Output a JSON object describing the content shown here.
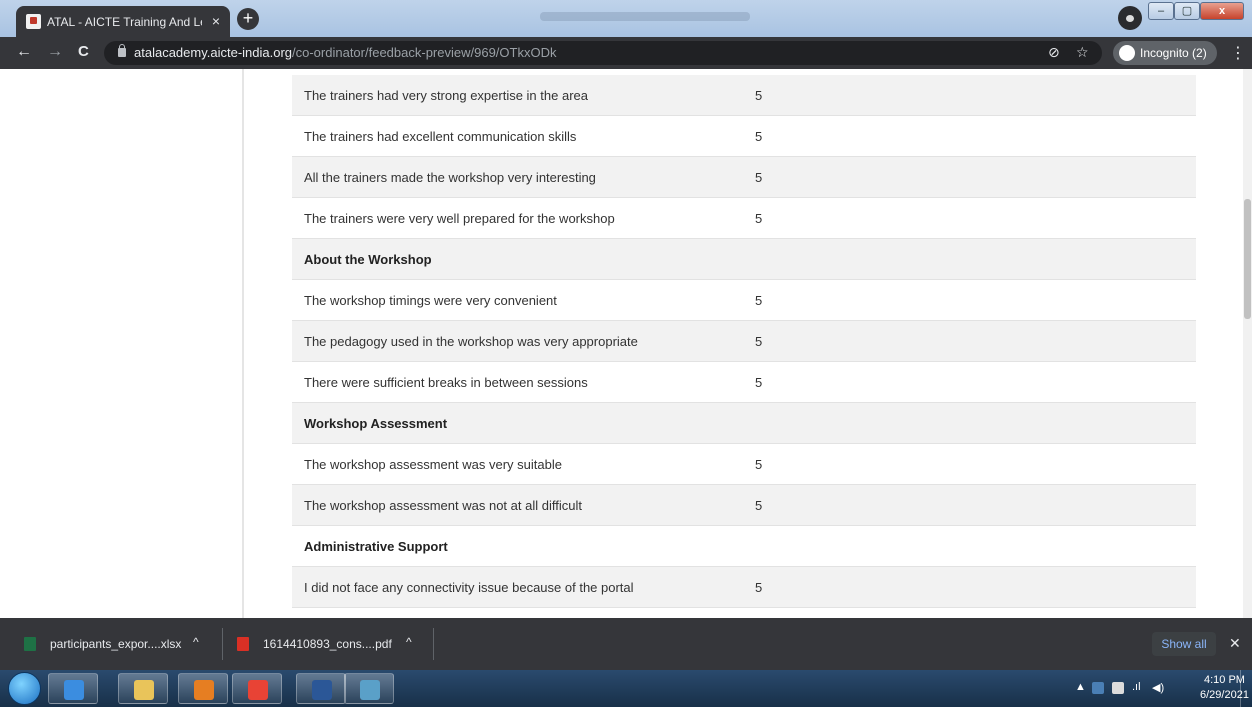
{
  "browser": {
    "tab_title": "ATAL - AICTE Training And Learn",
    "tab_close": "×",
    "new_tab": "+",
    "url_host": "atalacademy.aicte-india.org",
    "url_path": "/co-ordinator/feedback-preview/969/OTkxODk",
    "incognito_label": "Incognito (2)",
    "window_buttons": {
      "minimize": "–",
      "maximize": "▢",
      "close": "x"
    },
    "nav": {
      "back": "←",
      "forward": "→",
      "reload": "C"
    },
    "menu": "⋮"
  },
  "feedback_rows": [
    {
      "question": "The trainers had very strong expertise in the area",
      "rating": "5",
      "section": false
    },
    {
      "question": "The trainers had excellent communication skills",
      "rating": "5",
      "section": false
    },
    {
      "question": "All the trainers made the workshop very interesting",
      "rating": "5",
      "section": false
    },
    {
      "question": "The trainers were very well prepared for the workshop",
      "rating": "5",
      "section": false
    },
    {
      "question": "About the Workshop",
      "rating": "",
      "section": true
    },
    {
      "question": "The workshop timings were very convenient",
      "rating": "5",
      "section": false
    },
    {
      "question": "The pedagogy used in the workshop was very appropriate",
      "rating": "5",
      "section": false
    },
    {
      "question": "There were sufficient breaks in between sessions",
      "rating": "5",
      "section": false
    },
    {
      "question": "Workshop Assessment",
      "rating": "",
      "section": true
    },
    {
      "question": "The workshop assessment was very suitable",
      "rating": "5",
      "section": false
    },
    {
      "question": "The workshop assessment was not at all difficult",
      "rating": "5",
      "section": false
    },
    {
      "question": "Administrative Support",
      "rating": "",
      "section": true
    },
    {
      "question": "I did not face any connectivity issue because of the portal",
      "rating": "5",
      "section": false
    }
  ],
  "downloads": {
    "items": [
      {
        "name": "participants_expor....xlsx",
        "icon": "excel-file-icon",
        "color": "#1e7145"
      },
      {
        "name": "1614410893_cons....pdf",
        "icon": "pdf-file-icon",
        "color": "#d93025"
      }
    ],
    "chevron": "^",
    "show_all": "Show all",
    "close": "✕"
  },
  "taskbar": {
    "time": "4:10 PM",
    "date": "6/29/2021",
    "apps": [
      {
        "icon": "internet-explorer-icon",
        "color": "#3b8de0"
      },
      {
        "icon": "file-explorer-icon",
        "color": "#e9c45a"
      },
      {
        "icon": "outlook-icon",
        "color": "#e67e22"
      },
      {
        "icon": "chrome-icon",
        "color": "#e84335"
      },
      {
        "icon": "word-icon",
        "color": "#2b5797"
      },
      {
        "icon": "photo-viewer-icon",
        "color": "#5aa0c8"
      }
    ]
  }
}
